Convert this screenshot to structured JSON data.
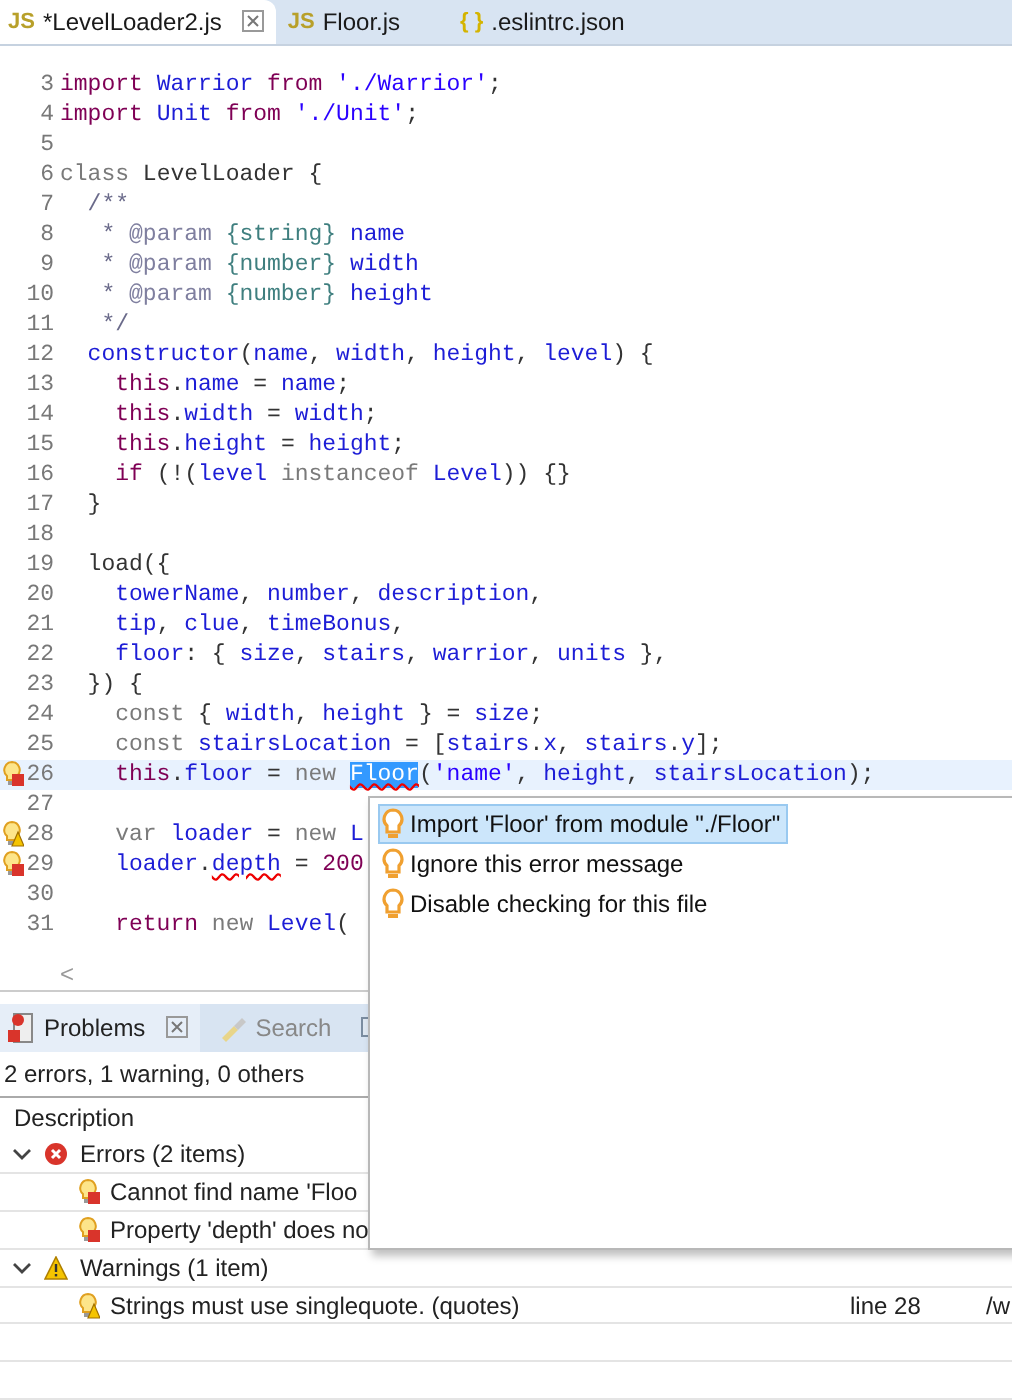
{
  "editor_tabs": [
    {
      "icon_text": "JS",
      "kind": "js",
      "label": "*LevelLoader2.js",
      "selected": true,
      "closable": true
    },
    {
      "icon_text": "JS",
      "kind": "js",
      "label": "Floor.js",
      "selected": false,
      "closable": false
    },
    {
      "icon_text": "{ }",
      "kind": "json",
      "label": ".eslintrc.json",
      "selected": false,
      "closable": false
    }
  ],
  "editor": {
    "lines": [
      {
        "number": "3",
        "selected": false,
        "tokens": [
          {
            "kind": "kw",
            "text": "import"
          },
          {
            "kind": "id",
            "text": " Warrior"
          },
          {
            "kind": "kw",
            "text": " from"
          },
          {
            "kind": "str",
            "text": " './Warrior'"
          },
          {
            "kind": "p",
            "text": ";"
          }
        ]
      },
      {
        "number": "4",
        "selected": false,
        "tokens": [
          {
            "kind": "kw",
            "text": "import"
          },
          {
            "kind": "id",
            "text": " Unit"
          },
          {
            "kind": "kw",
            "text": " from"
          },
          {
            "kind": "str",
            "text": " './Unit'"
          },
          {
            "kind": "p",
            "text": ";"
          }
        ]
      },
      {
        "number": "5",
        "selected": false
      },
      {
        "number": "6",
        "selected": false,
        "tokens": [
          {
            "kind": "gray",
            "text": "class"
          },
          {
            "kind": "p",
            "text": " LevelLoader {"
          }
        ]
      },
      {
        "number": "7",
        "selected": false,
        "tokens": [
          {
            "kind": "doc",
            "text": "  /**"
          }
        ]
      },
      {
        "number": "8",
        "selected": false,
        "tokens": [
          {
            "kind": "doc",
            "text": "   *"
          },
          {
            "kind": "tag",
            "text": " @param"
          },
          {
            "kind": "type",
            "text": " {string}"
          },
          {
            "kind": "id",
            "text": " name"
          }
        ]
      },
      {
        "number": "9",
        "selected": false,
        "tokens": [
          {
            "kind": "doc",
            "text": "   *"
          },
          {
            "kind": "tag",
            "text": " @param"
          },
          {
            "kind": "type",
            "text": " {number}"
          },
          {
            "kind": "id",
            "text": " width"
          }
        ]
      },
      {
        "number": "10",
        "selected": false,
        "tokens": [
          {
            "kind": "doc",
            "text": "   *"
          },
          {
            "kind": "tag",
            "text": " @param"
          },
          {
            "kind": "type",
            "text": " {number}"
          },
          {
            "kind": "id",
            "text": " height"
          }
        ]
      },
      {
        "number": "11",
        "selected": false,
        "tokens": [
          {
            "kind": "doc",
            "text": "   */"
          }
        ]
      },
      {
        "number": "12",
        "selected": false,
        "tokens": [
          {
            "kind": "id",
            "text": "  constructor"
          },
          {
            "kind": "p",
            "text": "("
          },
          {
            "kind": "id",
            "text": "name"
          },
          {
            "kind": "p",
            "text": ","
          },
          {
            "kind": "id",
            "text": " width"
          },
          {
            "kind": "p",
            "text": ","
          },
          {
            "kind": "id",
            "text": " height"
          },
          {
            "kind": "p",
            "text": ","
          },
          {
            "kind": "id",
            "text": " level"
          },
          {
            "kind": "p",
            "text": ") {"
          }
        ]
      },
      {
        "number": "13",
        "selected": false,
        "tokens": [
          {
            "kind": "kw",
            "text": "    this"
          },
          {
            "kind": "p",
            "text": "."
          },
          {
            "kind": "id",
            "text": "name"
          },
          {
            "kind": "p",
            "text": " ="
          },
          {
            "kind": "id",
            "text": " name"
          },
          {
            "kind": "p",
            "text": ";"
          }
        ]
      },
      {
        "number": "14",
        "selected": false,
        "tokens": [
          {
            "kind": "kw",
            "text": "    this"
          },
          {
            "kind": "p",
            "text": "."
          },
          {
            "kind": "id",
            "text": "width"
          },
          {
            "kind": "p",
            "text": " ="
          },
          {
            "kind": "id",
            "text": " width"
          },
          {
            "kind": "p",
            "text": ";"
          }
        ]
      },
      {
        "number": "15",
        "selected": false,
        "tokens": [
          {
            "kind": "kw",
            "text": "    this"
          },
          {
            "kind": "p",
            "text": "."
          },
          {
            "kind": "id",
            "text": "height"
          },
          {
            "kind": "p",
            "text": " ="
          },
          {
            "kind": "id",
            "text": " height"
          },
          {
            "kind": "p",
            "text": ";"
          }
        ]
      },
      {
        "number": "16",
        "selected": false,
        "tokens": [
          {
            "kind": "kw",
            "text": "    if"
          },
          {
            "kind": "p",
            "text": " (!("
          },
          {
            "kind": "id",
            "text": "level"
          },
          {
            "kind": "gray",
            "text": " instanceof"
          },
          {
            "kind": "id",
            "text": " Level"
          },
          {
            "kind": "p",
            "text": ")) {}"
          }
        ]
      },
      {
        "number": "17",
        "selected": false,
        "tokens": [
          {
            "kind": "p",
            "text": "  }"
          }
        ]
      },
      {
        "number": "18",
        "selected": false
      },
      {
        "number": "19",
        "selected": false,
        "tokens": [
          {
            "kind": "p",
            "text": "  load({"
          }
        ]
      },
      {
        "number": "20",
        "selected": false,
        "tokens": [
          {
            "kind": "id",
            "text": "    towerName"
          },
          {
            "kind": "p",
            "text": ","
          },
          {
            "kind": "id",
            "text": " number"
          },
          {
            "kind": "p",
            "text": ","
          },
          {
            "kind": "id",
            "text": " description"
          },
          {
            "kind": "p",
            "text": ","
          }
        ]
      },
      {
        "number": "21",
        "selected": false,
        "tokens": [
          {
            "kind": "id",
            "text": "    tip"
          },
          {
            "kind": "p",
            "text": ","
          },
          {
            "kind": "id",
            "text": " clue"
          },
          {
            "kind": "p",
            "text": ","
          },
          {
            "kind": "id",
            "text": " timeBonus"
          },
          {
            "kind": "p",
            "text": ","
          }
        ]
      },
      {
        "number": "22",
        "selected": false,
        "tokens": [
          {
            "kind": "id",
            "text": "    floor"
          },
          {
            "kind": "p",
            "text": ": {"
          },
          {
            "kind": "id",
            "text": " size"
          },
          {
            "kind": "p",
            "text": ","
          },
          {
            "kind": "id",
            "text": " stairs"
          },
          {
            "kind": "p",
            "text": ","
          },
          {
            "kind": "id",
            "text": " warrior"
          },
          {
            "kind": "p",
            "text": ","
          },
          {
            "kind": "id",
            "text": " units"
          },
          {
            "kind": "p",
            "text": " },"
          }
        ]
      },
      {
        "number": "23",
        "selected": false,
        "tokens": [
          {
            "kind": "p",
            "text": "  }) {"
          }
        ]
      },
      {
        "number": "24",
        "selected": false,
        "tokens": [
          {
            "kind": "gray",
            "text": "    const"
          },
          {
            "kind": "p",
            "text": " {"
          },
          {
            "kind": "id",
            "text": " width"
          },
          {
            "kind": "p",
            "text": ","
          },
          {
            "kind": "id",
            "text": " height"
          },
          {
            "kind": "p",
            "text": " } ="
          },
          {
            "kind": "id",
            "text": " size"
          },
          {
            "kind": "p",
            "text": ";"
          }
        ]
      },
      {
        "number": "25",
        "selected": false,
        "tokens": [
          {
            "kind": "gray",
            "text": "    const"
          },
          {
            "kind": "id",
            "text": " stairsLocation"
          },
          {
            "kind": "p",
            "text": " = ["
          },
          {
            "kind": "id",
            "text": "stairs"
          },
          {
            "kind": "p",
            "text": "."
          },
          {
            "kind": "id",
            "text": "x"
          },
          {
            "kind": "p",
            "text": ","
          },
          {
            "kind": "id",
            "text": " stairs"
          },
          {
            "kind": "p",
            "text": "."
          },
          {
            "kind": "id",
            "text": "y"
          },
          {
            "kind": "p",
            "text": "];"
          }
        ]
      },
      {
        "number": "26",
        "selected": true,
        "kind": "error",
        "tokens": [
          {
            "kind": "kw",
            "text": "    this"
          },
          {
            "kind": "p",
            "text": "."
          },
          {
            "kind": "id",
            "text": "floor"
          },
          {
            "kind": "p",
            "text": " ="
          },
          {
            "kind": "gray",
            "text": " new "
          },
          {
            "kind": "sel",
            "text": "Floor"
          },
          {
            "kind": "p",
            "text": "("
          },
          {
            "kind": "str",
            "text": "'name'"
          },
          {
            "kind": "p",
            "text": ","
          },
          {
            "kind": "id",
            "text": " height"
          },
          {
            "kind": "p",
            "text": ","
          },
          {
            "kind": "id",
            "text": " stairsLocation"
          },
          {
            "kind": "p",
            "text": ");"
          }
        ]
      },
      {
        "number": "27",
        "selected": false
      },
      {
        "number": "28",
        "selected": false,
        "kind": "warning",
        "tokens": [
          {
            "kind": "gray",
            "text": "    var"
          },
          {
            "kind": "id",
            "text": " loader"
          },
          {
            "kind": "p",
            "text": " ="
          },
          {
            "kind": "gray",
            "text": " new"
          },
          {
            "kind": "id",
            "text": " L"
          }
        ]
      },
      {
        "number": "29",
        "selected": false,
        "kind": "error",
        "tokens": [
          {
            "kind": "id",
            "text": "    loader"
          },
          {
            "kind": "p",
            "text": "."
          },
          {
            "kind": "err",
            "text": "depth"
          },
          {
            "kind": "p",
            "text": " ="
          },
          {
            "kind": "num",
            "text": " 200"
          }
        ]
      },
      {
        "number": "30",
        "selected": false
      },
      {
        "number": "31",
        "selected": false,
        "tokens": [
          {
            "kind": "kw",
            "text": "    return"
          },
          {
            "kind": "gray",
            "text": " new"
          },
          {
            "kind": "id",
            "text": " Level"
          },
          {
            "kind": "p",
            "text": "("
          }
        ]
      }
    ],
    "scroll_left": "<"
  },
  "quick_fix": [
    {
      "label": "Import 'Floor' from module \"./Floor\"",
      "selected": true
    },
    {
      "label": "Ignore this error message",
      "selected": false
    },
    {
      "label": "Disable checking for this file",
      "selected": false
    }
  ],
  "panel_tabs": [
    {
      "label": "Problems",
      "kind": "problems",
      "selected": true,
      "closable": true
    },
    {
      "label": "Search",
      "kind": "search",
      "selected": false,
      "closable": false
    },
    {
      "kind": "console",
      "selected": false,
      "closable": false
    }
  ],
  "problems": {
    "summary": "2 errors, 1 warning, 0 others",
    "columns": [
      "Description"
    ],
    "groups": [
      {
        "kind": "error",
        "label": "Errors (2 items)",
        "expanded": true,
        "items": [
          {
            "description": "Cannot find name 'Floo"
          },
          {
            "description": "Property 'depth' does no"
          }
        ]
      },
      {
        "kind": "warning",
        "label": "Warnings (1 item)",
        "expanded": true,
        "items": [
          {
            "description": "Strings must use singlequote. (quotes)",
            "location": "line 28",
            "path": "/w"
          }
        ]
      }
    ]
  }
}
